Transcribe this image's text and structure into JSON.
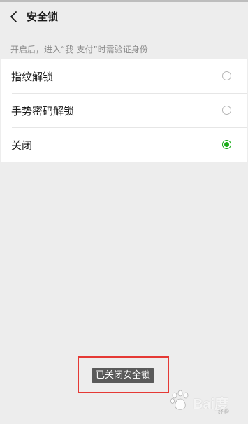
{
  "header": {
    "title": "安全锁"
  },
  "hint": "开启后，进入“我-支付”时需验证身份",
  "options": [
    {
      "label": "指纹解锁",
      "selected": false
    },
    {
      "label": "手势密码解锁",
      "selected": false
    },
    {
      "label": "关闭",
      "selected": true
    }
  ],
  "toast": "已关闭安全锁",
  "watermark": {
    "logo_text": "Bai度",
    "sub_text": "经验"
  },
  "colors": {
    "accent": "#1aad19",
    "background": "#ededed",
    "highlight": "#e53935"
  }
}
